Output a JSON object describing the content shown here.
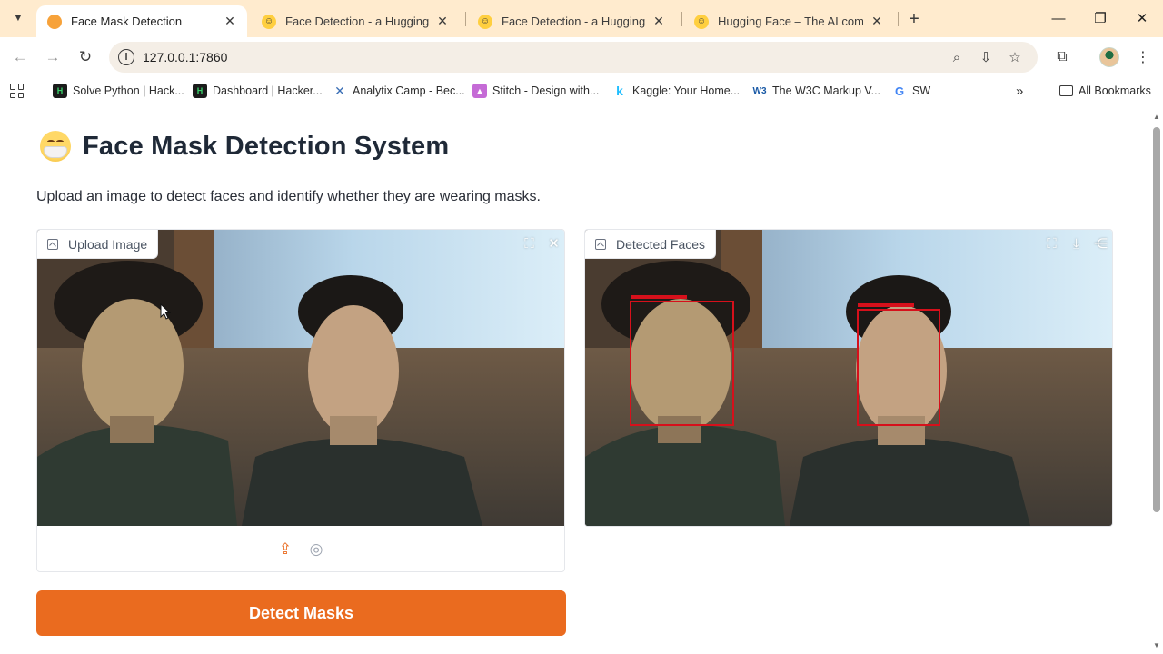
{
  "browser": {
    "tabs": [
      {
        "title": "Face Mask Detection",
        "active": true
      },
      {
        "title": "Face Detection - a Hugging Fac",
        "active": false
      },
      {
        "title": "Face Detection - a Hugging Fac",
        "active": false
      },
      {
        "title": "Hugging Face – The AI commun",
        "active": false
      }
    ],
    "url": "127.0.0.1:7860",
    "bookmarks": [
      {
        "label": "Solve Python | Hack...",
        "icon": "hackerrank-icon"
      },
      {
        "label": "Dashboard | Hacker...",
        "icon": "hackerrank-icon"
      },
      {
        "label": "Analytix Camp - Bec...",
        "icon": "analytix-icon"
      },
      {
        "label": "Stitch - Design with...",
        "icon": "stitch-icon"
      },
      {
        "label": "Kaggle: Your Home...",
        "icon": "kaggle-icon"
      },
      {
        "label": "The W3C Markup V...",
        "icon": "w3c-icon"
      },
      {
        "label": "SW",
        "icon": "google-icon"
      }
    ],
    "all_bookmarks": "All Bookmarks"
  },
  "app": {
    "title": "Face Mask Detection System",
    "subtitle": "Upload an image to detect faces and identify whether they are wearing masks.",
    "upload_label": "Upload Image",
    "output_label": "Detected Faces",
    "detect_button": "Detect Masks"
  },
  "colors": {
    "accent": "#ea6b1f",
    "tabstrip": "#ffebce",
    "detection_box": "#d6101b"
  }
}
